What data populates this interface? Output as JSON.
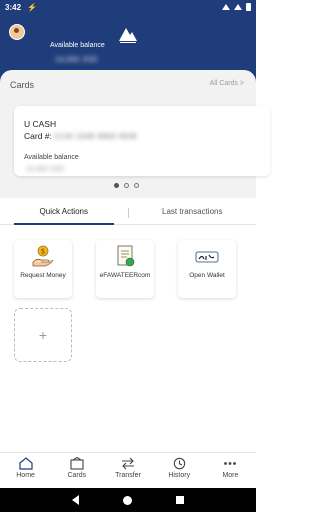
{
  "status": {
    "time": "3:42",
    "notification_glyph": "⚡"
  },
  "header": {
    "available_balance_label": "Available balance",
    "available_balance_value": "14,000 JOD"
  },
  "cards_section": {
    "title": "Cards",
    "all_cards_label": "All Cards >",
    "card": {
      "name": "U CASH",
      "number_label": "Card #:",
      "number_value": "5134 1948 4869 4948",
      "balance_label": "Available balance",
      "balance_value": "14,000 USD"
    }
  },
  "tabs": {
    "quick_actions": "Quick Actions",
    "last_transactions": "Last transactions"
  },
  "quick_actions": [
    {
      "label": "Request Money",
      "icon": "hand-coin-icon"
    },
    {
      "label": "eFAWATEERcom",
      "icon": "invoice-icon"
    },
    {
      "label": "Open Wallet",
      "icon": "wallet-arabic-icon"
    }
  ],
  "add_tile_symbol": "+",
  "nav": {
    "home": "Home",
    "cards": "Cards",
    "transfer": "Transfer",
    "history": "History",
    "more": "More"
  },
  "colors": {
    "brand": "#1f3d7a",
    "background": "#f2f2f2"
  }
}
